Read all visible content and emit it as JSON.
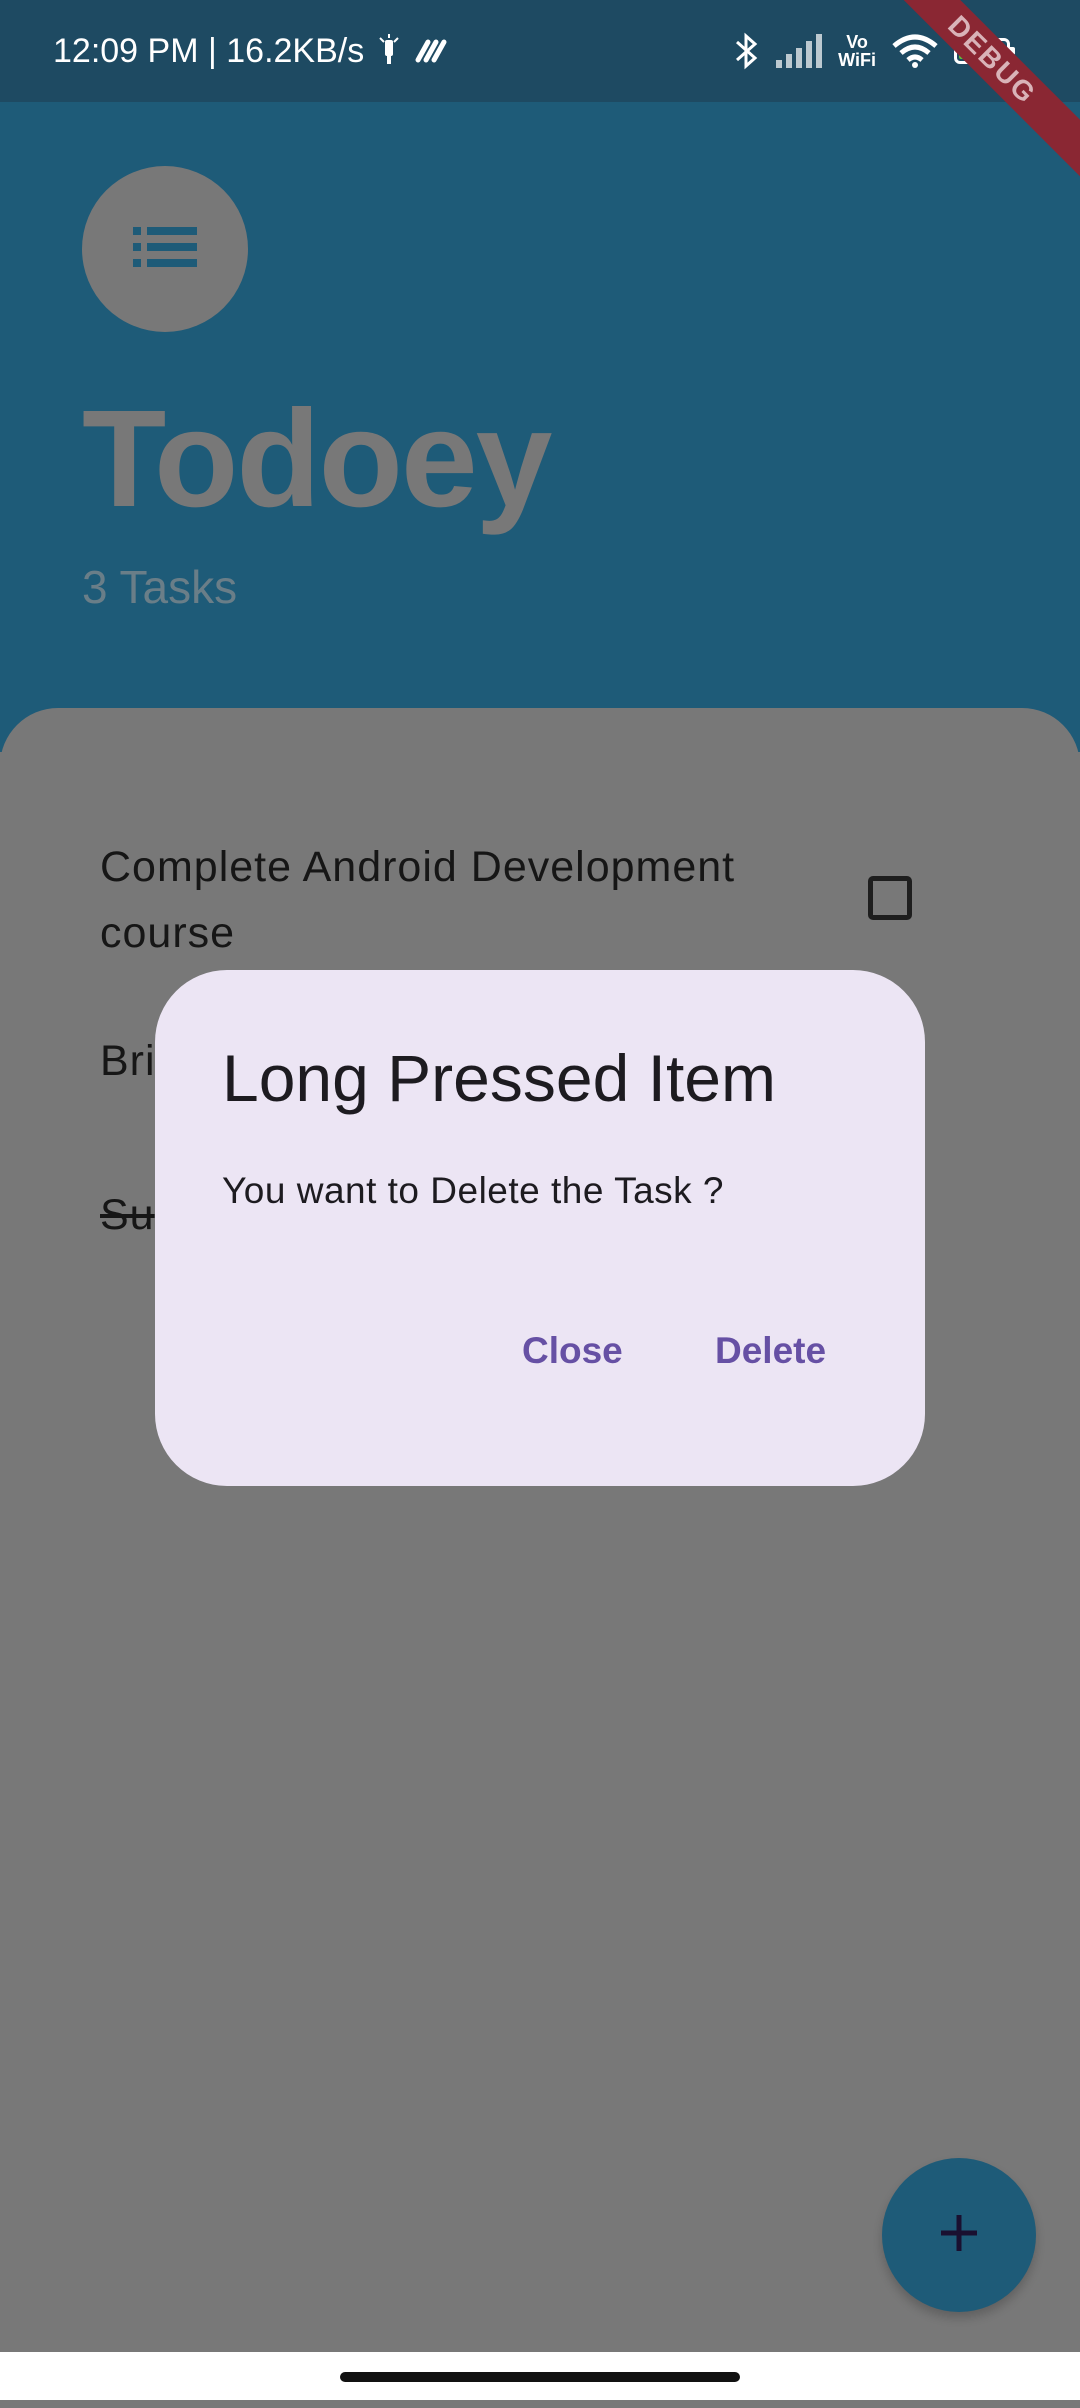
{
  "status_bar": {
    "time_speed": "12:09 PM | 16.2KB/s",
    "network_label": "Vo\nWiFi",
    "battery": "91",
    "icons": [
      "notification-icon",
      "app-icon",
      "bluetooth-icon",
      "signal-icon",
      "vowifi-icon",
      "wifi-icon",
      "battery-icon"
    ]
  },
  "debug_banner": "DEBUG",
  "header": {
    "menu_icon": "list-icon",
    "title": "Todoey",
    "task_count": "3 Tasks"
  },
  "tasks": [
    {
      "label": "Complete Android Development course",
      "checked": false
    },
    {
      "label": "Bri",
      "checked": false
    },
    {
      "label": "Su",
      "checked": true
    }
  ],
  "dialog": {
    "title": "Long Pressed Item",
    "message": "You want to Delete the Task ?",
    "close_label": "Close",
    "delete_label": "Delete"
  },
  "fab": {
    "icon": "plus-icon"
  },
  "colors": {
    "header": "#1e5b78",
    "status_bar": "#1e4a62",
    "scrim": "#787878",
    "dialog_bg": "#ece5f4",
    "dialog_accent": "#6650a4"
  }
}
